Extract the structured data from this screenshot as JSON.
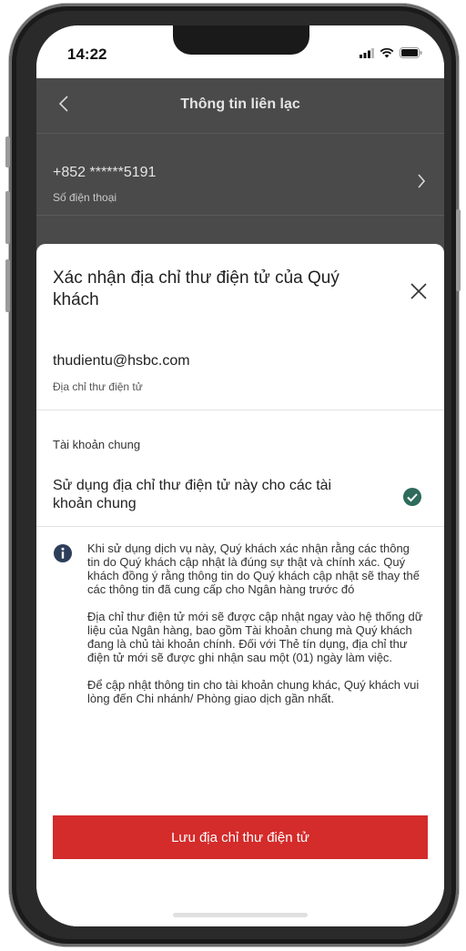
{
  "status_bar": {
    "time": "14:22"
  },
  "nav": {
    "title": "Thông tin liên lạc"
  },
  "contact_row": {
    "phone_value": "+852 ******5191",
    "phone_label": "Số điện thoại"
  },
  "sheet": {
    "title": "Xác nhận địa chỉ thư điện tử của Quý khách",
    "email_value": "thudientu@hsbc.com",
    "email_label": "Địa chỉ thư điện tử",
    "joint_heading": "Tài khoản chung",
    "joint_option_label": "Sử dụng địa chỉ thư điện tử này cho các tài khoản chung",
    "joint_option_checked": true,
    "notice_paragraphs": [
      "Khi sử dụng dịch vụ này, Quý khách xác nhận rằng các thông tin do Quý khách cập nhật là đúng sự thật và chính xác. Quý khách đồng ý rằng thông tin do Quý khách cập nhật sẽ thay thế các thông tin đã cung cấp cho Ngân hàng trước đó",
      "Địa chỉ thư điện tử mới sẽ được cập nhật ngay vào hệ thống dữ liệu của Ngân hàng, bao gồm Tài khoản chung mà Quý khách đang là chủ tài khoản chính. Đối với Thẻ tín dụng, địa chỉ thư điện tử mới sẽ được ghi nhận sau một (01) ngày làm việc.",
      "Để cập nhật thông tin cho tài khoản chung khác, Quý khách vui lòng đến Chi nhánh/ Phòng giao dịch gần nhất."
    ],
    "save_button_label": "Lưu địa chỉ thư điện tử"
  },
  "colors": {
    "accent": "#d42b2b",
    "check": "#2e6b5c",
    "info": "#2d3e5a",
    "overlay": "#4a4a4a"
  },
  "icons": {
    "back": "chevron-left-icon",
    "row": "chevron-right-icon",
    "close": "close-icon",
    "check": "check-circle-icon",
    "info": "info-icon"
  }
}
